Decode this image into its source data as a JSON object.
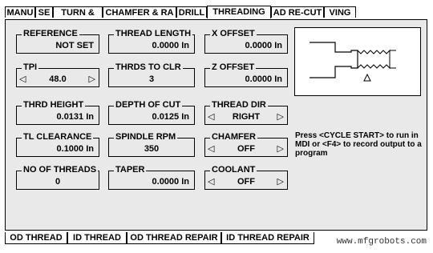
{
  "top_tabs": [
    {
      "label": "MANU"
    },
    {
      "label": "SE"
    },
    {
      "label": "TURN &"
    },
    {
      "label": "CHAMFER & RA"
    },
    {
      "label": "DRILL"
    },
    {
      "label": "THREADING"
    },
    {
      "label": "AD RE-CUT"
    },
    {
      "label": "VING"
    }
  ],
  "fields": {
    "reference": {
      "label": "REFERENCE",
      "value": "NOT SET"
    },
    "thread_length": {
      "label": "THREAD LENGTH",
      "value": "0.0000 In"
    },
    "x_offset": {
      "label": "X OFFSET",
      "value": "0.0000 In"
    },
    "tpi": {
      "label": "TPI",
      "value": "48.0"
    },
    "thrds_to_clr": {
      "label": "THRDS TO CLR",
      "value": "3"
    },
    "z_offset": {
      "label": "Z OFFSET",
      "value": "0.0000 In"
    },
    "thrd_height": {
      "label": "THRD HEIGHT",
      "value": "0.0131 In"
    },
    "depth_of_cut": {
      "label": "DEPTH OF CUT",
      "value": "0.0125 In"
    },
    "thread_dir": {
      "label": "THREAD DIR",
      "value": "RIGHT"
    },
    "tl_clearance": {
      "label": "TL CLEARANCE",
      "value": "0.1000 In"
    },
    "spindle_rpm": {
      "label": "SPINDLE RPM",
      "value": "350"
    },
    "chamfer": {
      "label": "CHAMFER",
      "value": "OFF"
    },
    "no_of_threads": {
      "label": "NO OF THREADS",
      "value": "0"
    },
    "taper": {
      "label": "TAPER",
      "value": "0.0000 In"
    },
    "coolant": {
      "label": "COOLANT",
      "value": "OFF"
    }
  },
  "arrows": {
    "left": "◁",
    "right": "▷"
  },
  "info_text": "Press <CYCLE START> to run in MDI or <F4> to record output to a program",
  "bottom_tabs": [
    {
      "label": "OD THREAD"
    },
    {
      "label": "ID THREAD"
    },
    {
      "label": "OD THREAD REPAIR"
    },
    {
      "label": "ID THREAD REPAIR"
    }
  ],
  "watermark": "www.mfgrobots.com"
}
